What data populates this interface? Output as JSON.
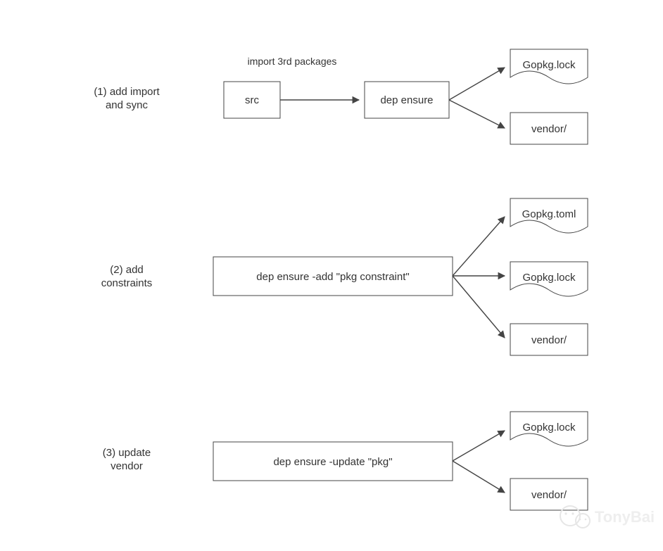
{
  "diagram": {
    "sections": [
      {
        "id": "s1",
        "title_l1": "(1) add import",
        "title_l2": "and sync",
        "caption": "import 3rd packages",
        "box_a": "src",
        "box_b": "dep ensure",
        "outputs": [
          {
            "label": "Gopkg.lock",
            "shape": "doc"
          },
          {
            "label": "vendor/",
            "shape": "rect"
          }
        ]
      },
      {
        "id": "s2",
        "title_l1": "(2) add",
        "title_l2": "constraints",
        "command": "dep ensure -add \"pkg constraint\"",
        "outputs": [
          {
            "label": "Gopkg.toml",
            "shape": "doc"
          },
          {
            "label": "Gopkg.lock",
            "shape": "doc"
          },
          {
            "label": "vendor/",
            "shape": "rect"
          }
        ]
      },
      {
        "id": "s3",
        "title_l1": "(3) update",
        "title_l2": "vendor",
        "command": "dep ensure -update \"pkg\"",
        "outputs": [
          {
            "label": "Gopkg.lock",
            "shape": "doc"
          },
          {
            "label": "vendor/",
            "shape": "rect"
          }
        ]
      }
    ],
    "watermark": "TonyBai"
  }
}
